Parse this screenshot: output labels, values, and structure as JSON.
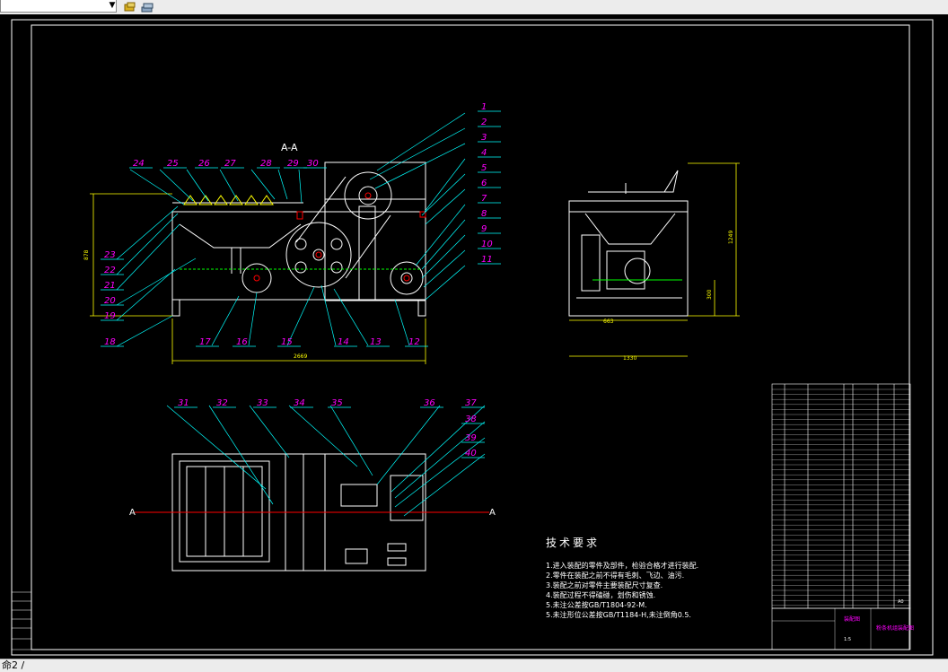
{
  "app": {
    "layer_selector_value": "",
    "command_line": "命2 /"
  },
  "colors": {
    "background": "#000000",
    "frame": "#ffffff",
    "leader": "#00ffff",
    "callout": "#ff00ff",
    "outline": "#ffffff",
    "dimension": "#ffff00",
    "hidden": "#00ff00",
    "accent": "#ff0000"
  },
  "drawing": {
    "section_label": "A-A",
    "section_marker": "A",
    "front_view_callouts_top": [
      "24",
      "25",
      "26",
      "27",
      "28",
      "29",
      "30"
    ],
    "front_view_callouts_left": [
      "23",
      "22",
      "21",
      "20",
      "19",
      "18"
    ],
    "front_view_callouts_bottom": [
      "17",
      "16",
      "15",
      "14",
      "13",
      "12"
    ],
    "front_view_callouts_right": [
      "1",
      "2",
      "3",
      "4",
      "5",
      "6",
      "7",
      "8",
      "9",
      "10",
      "11"
    ],
    "top_view_callouts": [
      "31",
      "32",
      "33",
      "34",
      "35",
      "36",
      "37",
      "38",
      "39",
      "40"
    ],
    "dimensions": {
      "front_width": "2669",
      "front_height": "878",
      "side_width": "1330",
      "side_height": "1249",
      "side_sub_width": "663",
      "side_sub_height": "300"
    }
  },
  "technical_requirements": {
    "title": "技术要求",
    "items": [
      "1.进入装配的零件及部件，检验合格才进行装配.",
      "2.零件在装配之前不得有毛刺、飞边、油污.",
      "3.装配之前对零件主要装配尺寸复查.",
      "4.装配过程不得磕碰，划伤和锈蚀.",
      "5.未注公差按GB/T1804-92-M.",
      "5.未注形位公差按GB/T1184-H,未注倒角0.5."
    ]
  },
  "title_block": {
    "company": "装配图",
    "drawing_name": "粉条机组装配图",
    "scale": "1:5",
    "sheet": "A0"
  }
}
